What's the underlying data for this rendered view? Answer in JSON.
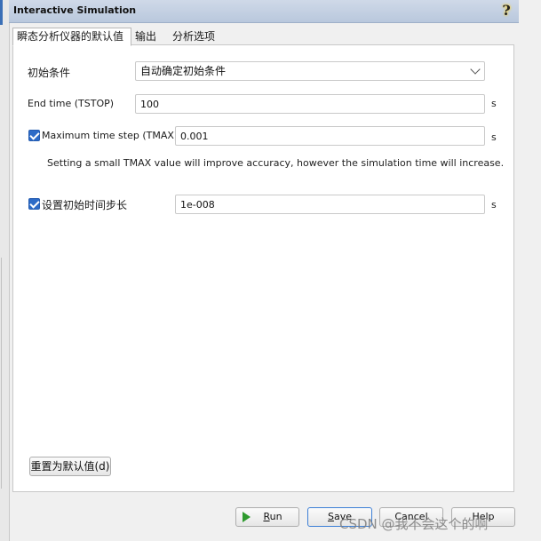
{
  "window": {
    "title": "Interactive Simulation",
    "help_icon": "help-question-icon"
  },
  "tabs": [
    {
      "label": "瞬态分析仪器的默认值",
      "active": true
    },
    {
      "label": "输出",
      "active": false
    },
    {
      "label": "分析选项",
      "active": false
    }
  ],
  "form": {
    "initial_conditions": {
      "label": "初始条件",
      "selected": "自动确定初始条件"
    },
    "end_time": {
      "label": "End time (TSTOP)",
      "value": "100",
      "unit": "s"
    },
    "max_step": {
      "checked": true,
      "label": "Maximum time step (TMAX):",
      "value": "0.001",
      "unit": "s"
    },
    "note": "Setting a small TMAX value will improve accuracy, however the simulation time will increase.",
    "initial_step": {
      "checked": true,
      "label": "设置初始时间步长",
      "value": "1e-008",
      "unit": "s"
    },
    "reset_button": "重置为默认值(d)"
  },
  "footer": {
    "run": {
      "label": "Run",
      "underline": "R",
      "rest": "un"
    },
    "save": {
      "label": "Save",
      "underline": "S",
      "rest": "ave"
    },
    "cancel": "Cancel",
    "help": "Help"
  },
  "watermark": "CSDN @我不会这个的啊",
  "colors": {
    "titlebar": "#b9c8dd",
    "checkbox": "#2d6bc7",
    "run_icon": "#2e9a2e",
    "default_button_border": "#3c7fd6"
  }
}
